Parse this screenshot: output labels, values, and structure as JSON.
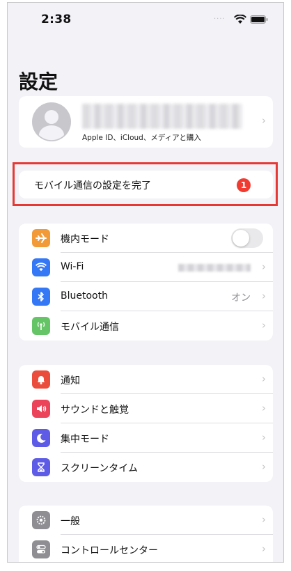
{
  "status_bar": {
    "time": "2:38",
    "signal_dots": "....",
    "wifi_icon": "wifi-icon",
    "battery_icon": "battery-icon"
  },
  "page": {
    "title": "設定"
  },
  "profile": {
    "avatar_icon": "person-silhouette-icon",
    "subtitle": "Apple ID、iCloud、メディアと購入",
    "chevron": "›"
  },
  "setup": {
    "label": "モバイル通信の設定を完了",
    "badge": "1"
  },
  "group1": {
    "items": [
      {
        "label": "機内モード",
        "icon": "airplane-icon",
        "color": "#f19a37",
        "toggle_on": false
      },
      {
        "label": "Wi-Fi",
        "icon": "wifi-icon",
        "color": "#3478f6",
        "value": ""
      },
      {
        "label": "Bluetooth",
        "icon": "bluetooth-icon",
        "color": "#3478f6",
        "value": "オン"
      },
      {
        "label": "モバイル通信",
        "icon": "antenna-icon",
        "color": "#65c466",
        "value": ""
      }
    ]
  },
  "group2": {
    "items": [
      {
        "label": "通知",
        "icon": "bell-icon",
        "color": "#eb4d3d"
      },
      {
        "label": "サウンドと触覚",
        "icon": "speaker-icon",
        "color": "#eb445a"
      },
      {
        "label": "集中モード",
        "icon": "moon-icon",
        "color": "#5e5ce6"
      },
      {
        "label": "スクリーンタイム",
        "icon": "hourglass-icon",
        "color": "#5e5ce6"
      }
    ]
  },
  "group3": {
    "items": [
      {
        "label": "一般",
        "icon": "gear-icon",
        "color": "#8e8e93"
      },
      {
        "label": "コントロールセンター",
        "icon": "toggles-icon",
        "color": "#8e8e93"
      }
    ]
  },
  "chevron": "›",
  "colors": {
    "background": "#f2f2f7",
    "highlight_border": "#e53935",
    "badge": "#f23b30"
  }
}
